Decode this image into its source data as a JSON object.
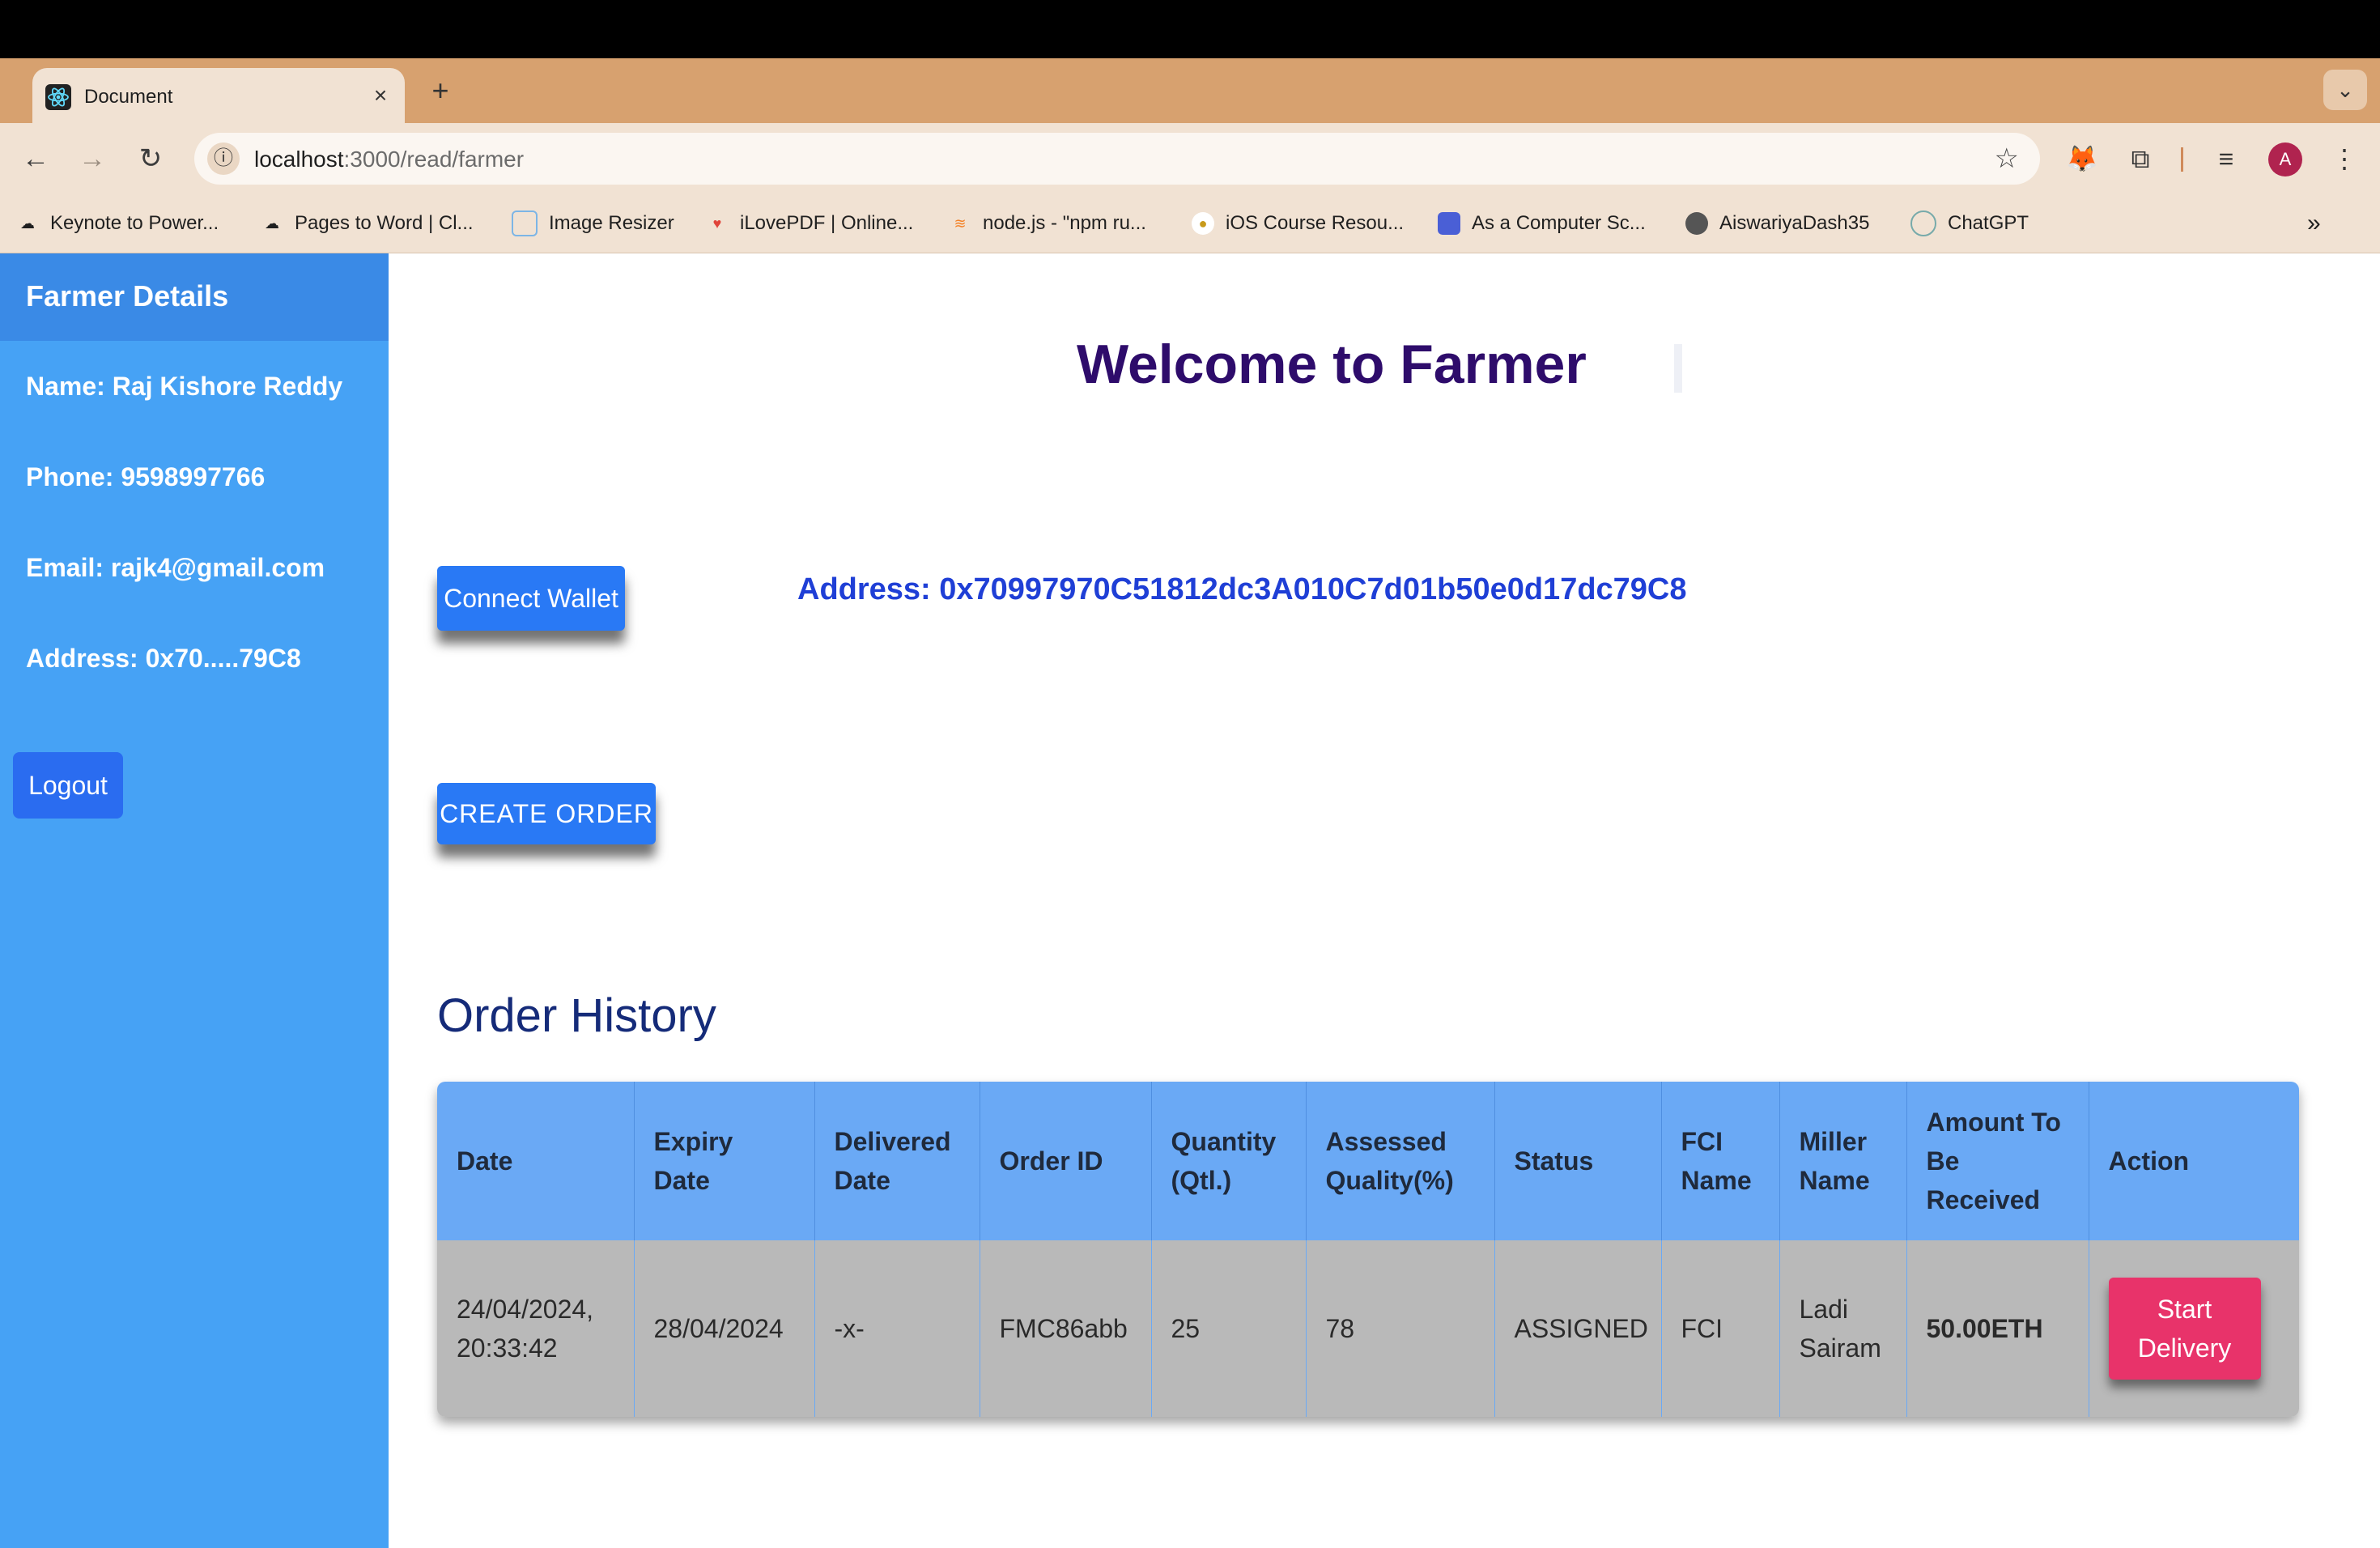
{
  "browser": {
    "tab_title": "Document",
    "url_host": "localhost",
    "url_path": ":3000/read/farmer",
    "bookmarks": [
      {
        "label": "Keynote to Power...",
        "icon": "cloud-icon"
      },
      {
        "label": "Pages to Word | Cl...",
        "icon": "cloud-icon"
      },
      {
        "label": "Image Resizer",
        "icon": "image-icon"
      },
      {
        "label": "iLovePDF | Online...",
        "icon": "heart-icon"
      },
      {
        "label": "node.js - \"npm ru...",
        "icon": "stackoverflow-icon"
      },
      {
        "label": "iOS Course Resou...",
        "icon": "course-icon"
      },
      {
        "label": "As a Computer Sc...",
        "icon": "printer-icon"
      },
      {
        "label": "AiswariyaDash35",
        "icon": "github-icon"
      },
      {
        "label": "ChatGPT",
        "icon": "chatgpt-icon"
      }
    ],
    "avatar_letter": "A"
  },
  "sidebar": {
    "title": "Farmer Details",
    "name": "Name: Raj Kishore Reddy",
    "phone": "Phone: 9598997766",
    "email": "Email: rajk4@gmail.com",
    "address": "Address: 0x70.....79C8",
    "logout_label": "Logout"
  },
  "main": {
    "welcome": "Welcome to Farmer",
    "connect_label": "Connect Wallet",
    "address_text": "Address: 0x70997970C51812dc3A010C7d01b50e0d17dc79C8",
    "create_label": "CREATE ORDER",
    "history_title": "Order History"
  },
  "table": {
    "headers": [
      "Date",
      "Expiry Date",
      "Delivered Date",
      "Order ID",
      "Quantity (Qtl.)",
      "Assessed Quality(%)",
      "Status",
      "FCI Name",
      "Miller Name",
      "Amount To Be Received",
      "Action"
    ],
    "row": {
      "date": "24/04/2024, 20:33:42",
      "expiry": "28/04/2024",
      "delivered": "-x-",
      "order_id": "FMC86abb",
      "quantity": "25",
      "quality": "78",
      "status": "ASSIGNED",
      "fci": "FCI",
      "miller": "Ladi Sairam",
      "amount": "50.00ETH",
      "action_label": "Start Delivery"
    }
  },
  "colors": {
    "sidebar": "#46a2f5",
    "button_blue": "#2979f5",
    "action_pink": "#e8336a",
    "header_blue": "#6aa9f5"
  }
}
